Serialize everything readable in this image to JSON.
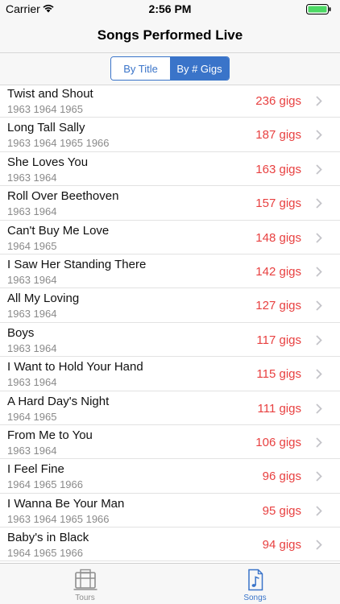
{
  "status_bar": {
    "carrier": "Carrier",
    "time": "2:56 PM"
  },
  "nav": {
    "title": "Songs Performed Live"
  },
  "segments": [
    {
      "label": "By Title",
      "active": false
    },
    {
      "label": "By # Gigs",
      "active": true
    }
  ],
  "songs": [
    {
      "title": "Twist and Shout",
      "years": "1963 1964 1965",
      "gigs": "236 gigs"
    },
    {
      "title": "Long Tall Sally",
      "years": "1963 1964 1965 1966",
      "gigs": "187 gigs"
    },
    {
      "title": "She Loves You",
      "years": "1963 1964",
      "gigs": "163 gigs"
    },
    {
      "title": "Roll Over Beethoven",
      "years": "1963 1964",
      "gigs": "157 gigs"
    },
    {
      "title": "Can't Buy Me Love",
      "years": "1964 1965",
      "gigs": "148 gigs"
    },
    {
      "title": "I Saw Her Standing There",
      "years": "1963 1964",
      "gigs": "142 gigs"
    },
    {
      "title": "All My Loving",
      "years": "1963 1964",
      "gigs": "127 gigs"
    },
    {
      "title": "Boys",
      "years": "1963 1964",
      "gigs": "117 gigs"
    },
    {
      "title": "I Want to Hold Your Hand",
      "years": "1963 1964",
      "gigs": "115 gigs"
    },
    {
      "title": "A Hard Day's Night",
      "years": "1964 1965",
      "gigs": "111 gigs"
    },
    {
      "title": "From Me to You",
      "years": "1963 1964",
      "gigs": "106 gigs"
    },
    {
      "title": "I Feel Fine",
      "years": "1964 1965 1966",
      "gigs": "96 gigs"
    },
    {
      "title": "I Wanna Be Your Man",
      "years": "1963 1964 1965 1966",
      "gigs": "95 gigs"
    },
    {
      "title": "Baby's in Black",
      "years": "1964 1965 1966",
      "gigs": "94 gigs"
    }
  ],
  "tabs": [
    {
      "label": "Tours",
      "icon": "tours-icon",
      "active": false
    },
    {
      "label": "Songs",
      "icon": "music-note-icon",
      "active": true
    }
  ],
  "colors": {
    "accent": "#3a74c9",
    "gigs": "#e84040"
  }
}
